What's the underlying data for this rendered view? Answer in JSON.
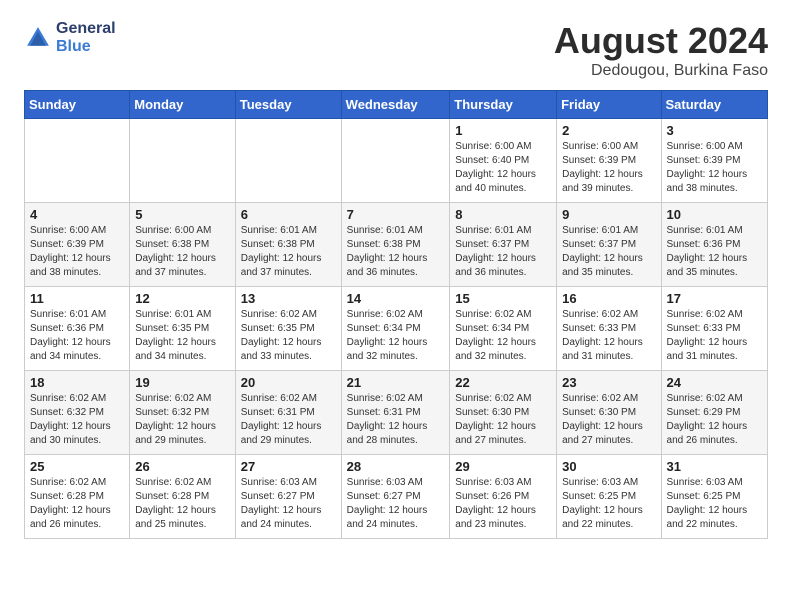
{
  "logo": {
    "line1": "General",
    "line2": "Blue"
  },
  "title": "August 2024",
  "location": "Dedougou, Burkina Faso",
  "weekdays": [
    "Sunday",
    "Monday",
    "Tuesday",
    "Wednesday",
    "Thursday",
    "Friday",
    "Saturday"
  ],
  "weeks": [
    [
      {
        "day": "",
        "info": ""
      },
      {
        "day": "",
        "info": ""
      },
      {
        "day": "",
        "info": ""
      },
      {
        "day": "",
        "info": ""
      },
      {
        "day": "1",
        "info": "Sunrise: 6:00 AM\nSunset: 6:40 PM\nDaylight: 12 hours\nand 40 minutes."
      },
      {
        "day": "2",
        "info": "Sunrise: 6:00 AM\nSunset: 6:39 PM\nDaylight: 12 hours\nand 39 minutes."
      },
      {
        "day": "3",
        "info": "Sunrise: 6:00 AM\nSunset: 6:39 PM\nDaylight: 12 hours\nand 38 minutes."
      }
    ],
    [
      {
        "day": "4",
        "info": "Sunrise: 6:00 AM\nSunset: 6:39 PM\nDaylight: 12 hours\nand 38 minutes."
      },
      {
        "day": "5",
        "info": "Sunrise: 6:00 AM\nSunset: 6:38 PM\nDaylight: 12 hours\nand 37 minutes."
      },
      {
        "day": "6",
        "info": "Sunrise: 6:01 AM\nSunset: 6:38 PM\nDaylight: 12 hours\nand 37 minutes."
      },
      {
        "day": "7",
        "info": "Sunrise: 6:01 AM\nSunset: 6:38 PM\nDaylight: 12 hours\nand 36 minutes."
      },
      {
        "day": "8",
        "info": "Sunrise: 6:01 AM\nSunset: 6:37 PM\nDaylight: 12 hours\nand 36 minutes."
      },
      {
        "day": "9",
        "info": "Sunrise: 6:01 AM\nSunset: 6:37 PM\nDaylight: 12 hours\nand 35 minutes."
      },
      {
        "day": "10",
        "info": "Sunrise: 6:01 AM\nSunset: 6:36 PM\nDaylight: 12 hours\nand 35 minutes."
      }
    ],
    [
      {
        "day": "11",
        "info": "Sunrise: 6:01 AM\nSunset: 6:36 PM\nDaylight: 12 hours\nand 34 minutes."
      },
      {
        "day": "12",
        "info": "Sunrise: 6:01 AM\nSunset: 6:35 PM\nDaylight: 12 hours\nand 34 minutes."
      },
      {
        "day": "13",
        "info": "Sunrise: 6:02 AM\nSunset: 6:35 PM\nDaylight: 12 hours\nand 33 minutes."
      },
      {
        "day": "14",
        "info": "Sunrise: 6:02 AM\nSunset: 6:34 PM\nDaylight: 12 hours\nand 32 minutes."
      },
      {
        "day": "15",
        "info": "Sunrise: 6:02 AM\nSunset: 6:34 PM\nDaylight: 12 hours\nand 32 minutes."
      },
      {
        "day": "16",
        "info": "Sunrise: 6:02 AM\nSunset: 6:33 PM\nDaylight: 12 hours\nand 31 minutes."
      },
      {
        "day": "17",
        "info": "Sunrise: 6:02 AM\nSunset: 6:33 PM\nDaylight: 12 hours\nand 31 minutes."
      }
    ],
    [
      {
        "day": "18",
        "info": "Sunrise: 6:02 AM\nSunset: 6:32 PM\nDaylight: 12 hours\nand 30 minutes."
      },
      {
        "day": "19",
        "info": "Sunrise: 6:02 AM\nSunset: 6:32 PM\nDaylight: 12 hours\nand 29 minutes."
      },
      {
        "day": "20",
        "info": "Sunrise: 6:02 AM\nSunset: 6:31 PM\nDaylight: 12 hours\nand 29 minutes."
      },
      {
        "day": "21",
        "info": "Sunrise: 6:02 AM\nSunset: 6:31 PM\nDaylight: 12 hours\nand 28 minutes."
      },
      {
        "day": "22",
        "info": "Sunrise: 6:02 AM\nSunset: 6:30 PM\nDaylight: 12 hours\nand 27 minutes."
      },
      {
        "day": "23",
        "info": "Sunrise: 6:02 AM\nSunset: 6:30 PM\nDaylight: 12 hours\nand 27 minutes."
      },
      {
        "day": "24",
        "info": "Sunrise: 6:02 AM\nSunset: 6:29 PM\nDaylight: 12 hours\nand 26 minutes."
      }
    ],
    [
      {
        "day": "25",
        "info": "Sunrise: 6:02 AM\nSunset: 6:28 PM\nDaylight: 12 hours\nand 26 minutes."
      },
      {
        "day": "26",
        "info": "Sunrise: 6:02 AM\nSunset: 6:28 PM\nDaylight: 12 hours\nand 25 minutes."
      },
      {
        "day": "27",
        "info": "Sunrise: 6:03 AM\nSunset: 6:27 PM\nDaylight: 12 hours\nand 24 minutes."
      },
      {
        "day": "28",
        "info": "Sunrise: 6:03 AM\nSunset: 6:27 PM\nDaylight: 12 hours\nand 24 minutes."
      },
      {
        "day": "29",
        "info": "Sunrise: 6:03 AM\nSunset: 6:26 PM\nDaylight: 12 hours\nand 23 minutes."
      },
      {
        "day": "30",
        "info": "Sunrise: 6:03 AM\nSunset: 6:25 PM\nDaylight: 12 hours\nand 22 minutes."
      },
      {
        "day": "31",
        "info": "Sunrise: 6:03 AM\nSunset: 6:25 PM\nDaylight: 12 hours\nand 22 minutes."
      }
    ]
  ]
}
